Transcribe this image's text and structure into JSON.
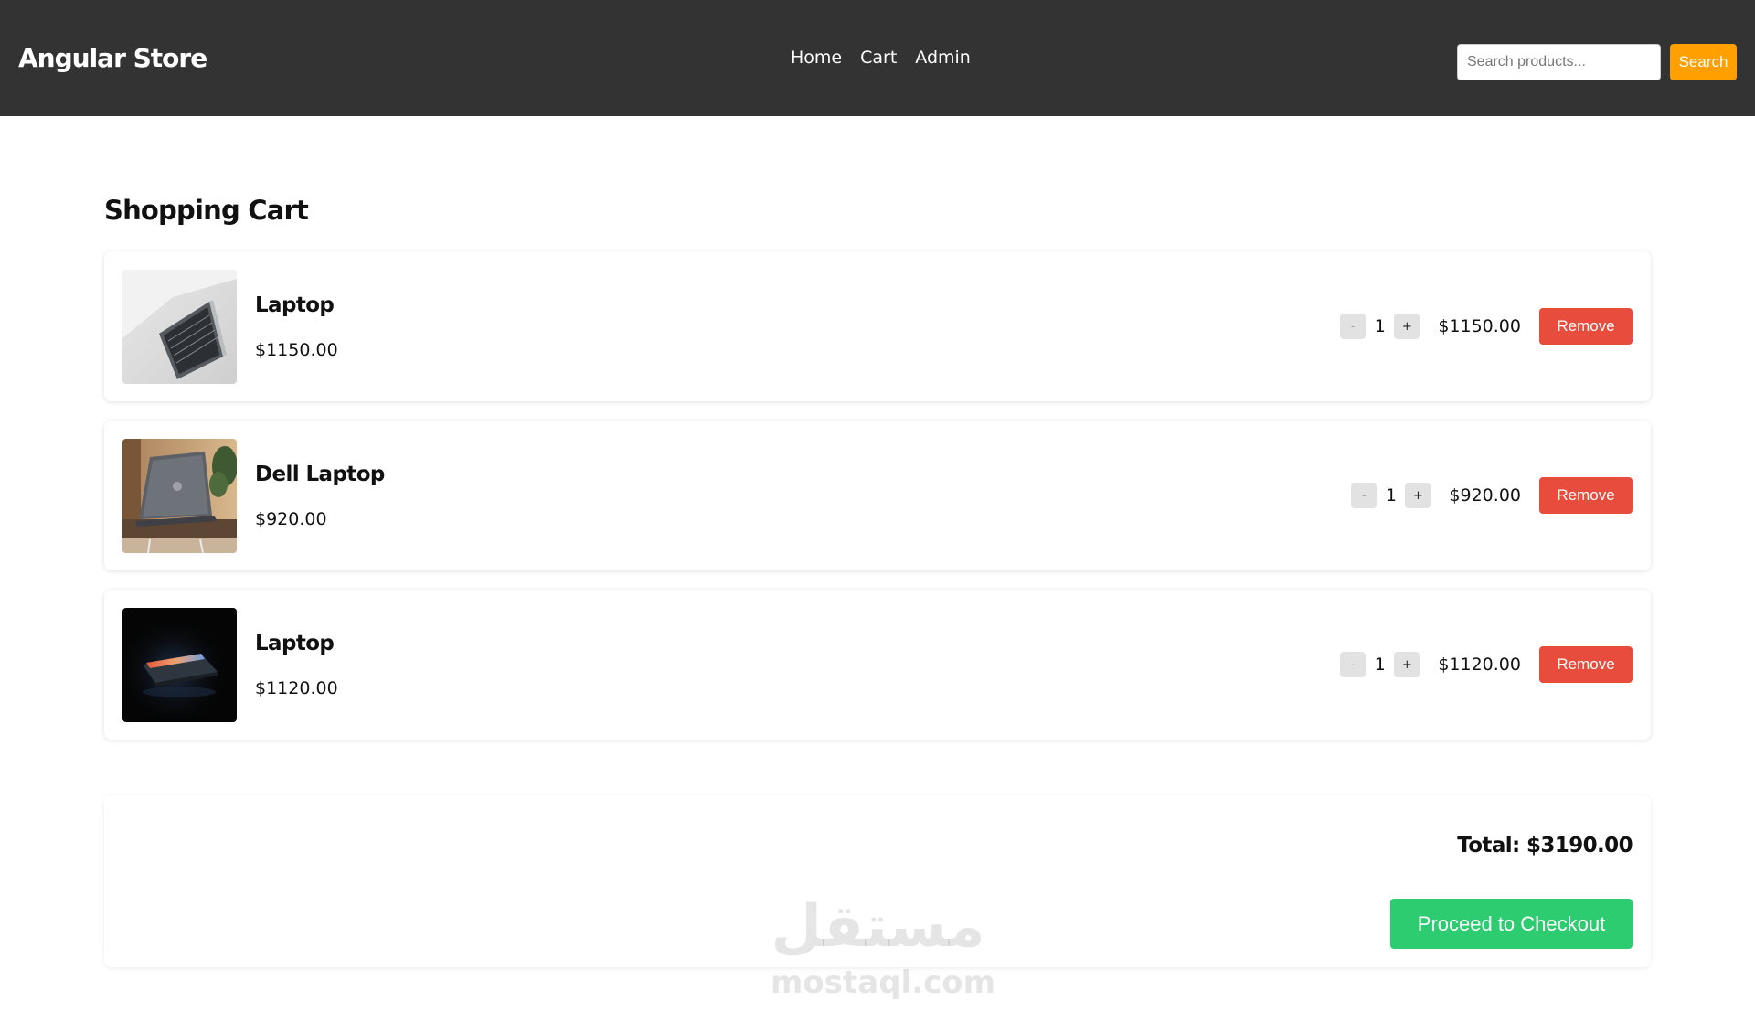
{
  "header": {
    "brand": "Angular Store",
    "nav": [
      "Home",
      "Cart",
      "Admin"
    ],
    "search_placeholder": "Search products...",
    "search_value": "",
    "search_button": "Search",
    "background_color": "#333333",
    "search_button_color": "#ff9f00"
  },
  "cart": {
    "title": "Shopping Cart",
    "items": [
      {
        "name": "Laptop",
        "price": "$1150.00",
        "decrement": "-",
        "quantity": "1",
        "increment": "+",
        "line_total": "$1150.00",
        "remove": "Remove",
        "image": "silver-laptop-image"
      },
      {
        "name": "Dell Laptop",
        "price": "$920.00",
        "decrement": "-",
        "quantity": "1",
        "increment": "+",
        "line_total": "$920.00",
        "remove": "Remove",
        "image": "dell-laptop-image"
      },
      {
        "name": "Laptop",
        "price": "$1120.00",
        "decrement": "-",
        "quantity": "1",
        "increment": "+",
        "line_total": "$1120.00",
        "remove": "Remove",
        "image": "dark-laptop-image"
      }
    ],
    "remove_button_color": "#e74c3c"
  },
  "summary": {
    "total": "Total: $3190.00",
    "checkout": "Proceed to Checkout",
    "checkout_button_color": "#2ecc71"
  },
  "watermark": {
    "arabic": "مستقل",
    "latin": "mostaql.com"
  }
}
